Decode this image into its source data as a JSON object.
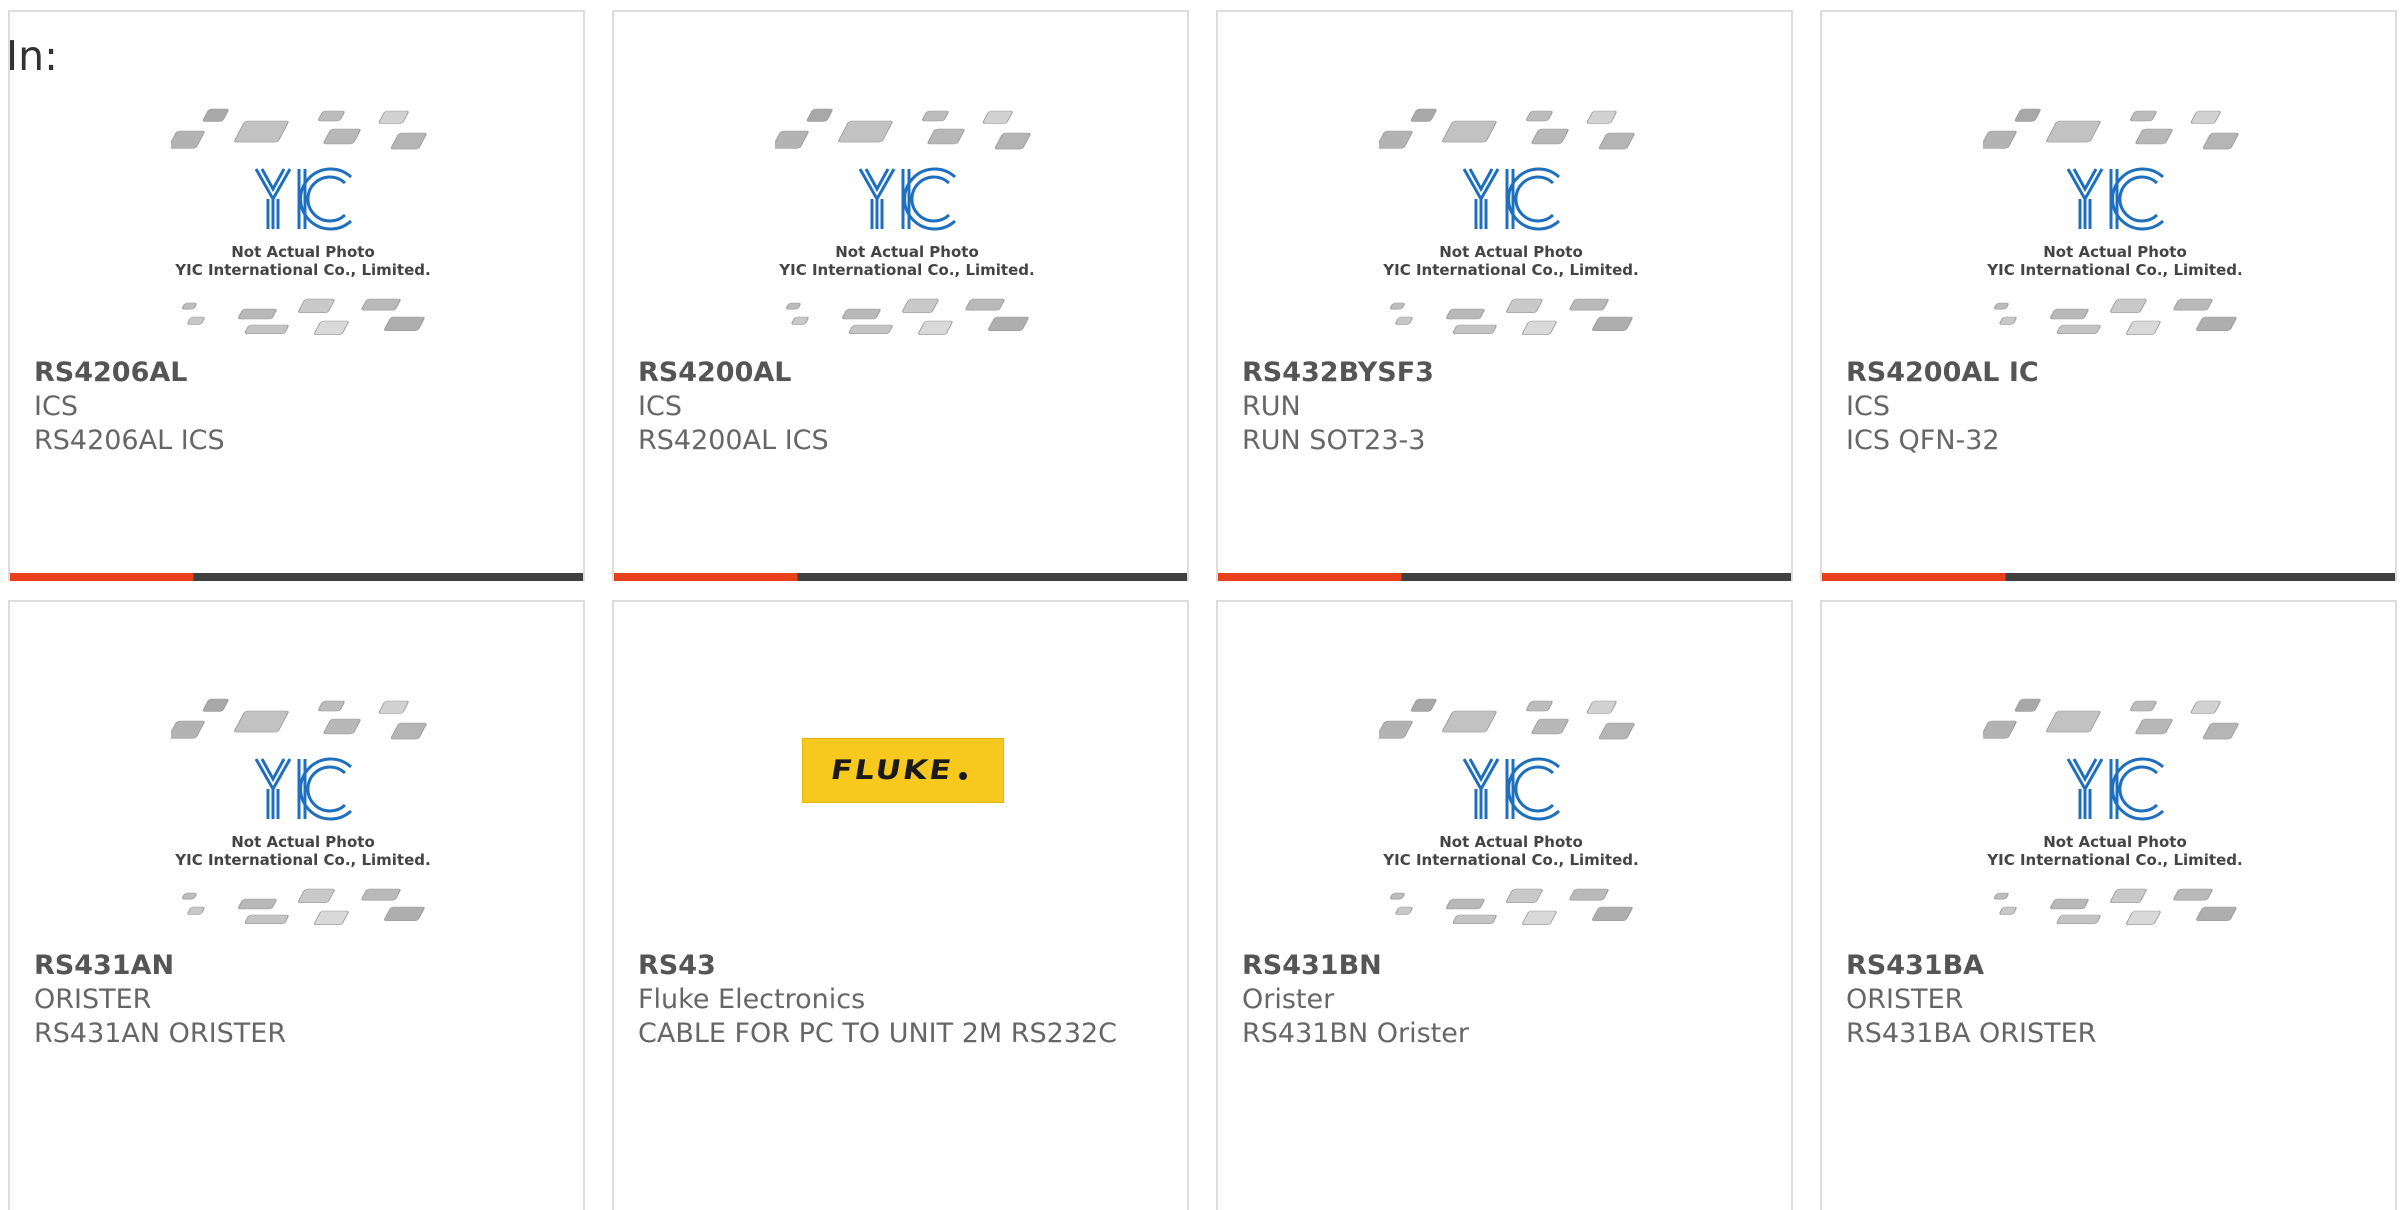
{
  "header": {
    "label": "In:"
  },
  "placeholder": {
    "logo_text": "YIC",
    "line1": "Not Actual Photo",
    "line2": "YIC International Co., Limited."
  },
  "fluke_logo": {
    "text": "FLUKE",
    "color": "#F7C81E"
  },
  "colors": {
    "accent_bar": "#E8401A",
    "dark_bar": "#404040",
    "logo_blue": "#1F6FBF"
  },
  "products": [
    {
      "part": "RS4206AL",
      "brand": "ICS",
      "desc": "RS4206AL ICS",
      "image": "placeholder"
    },
    {
      "part": "RS4200AL",
      "brand": "ICS",
      "desc": "RS4200AL ICS",
      "image": "placeholder"
    },
    {
      "part": "RS432BYSF3",
      "brand": "RUN",
      "desc": "RUN SOT23-3",
      "image": "placeholder"
    },
    {
      "part": "RS4200AL IC",
      "brand": "ICS",
      "desc": "ICS QFN-32",
      "image": "placeholder"
    },
    {
      "part": "RS431AN",
      "brand": "ORISTER",
      "desc": "RS431AN ORISTER",
      "image": "placeholder"
    },
    {
      "part": "RS43",
      "brand": "Fluke Electronics",
      "desc": "CABLE FOR PC TO UNIT 2M RS232C",
      "image": "fluke"
    },
    {
      "part": "RS431BN",
      "brand": "Orister",
      "desc": "RS431BN Orister",
      "image": "placeholder"
    },
    {
      "part": "RS431BA",
      "brand": "ORISTER",
      "desc": "RS431BA ORISTER",
      "image": "placeholder"
    }
  ]
}
